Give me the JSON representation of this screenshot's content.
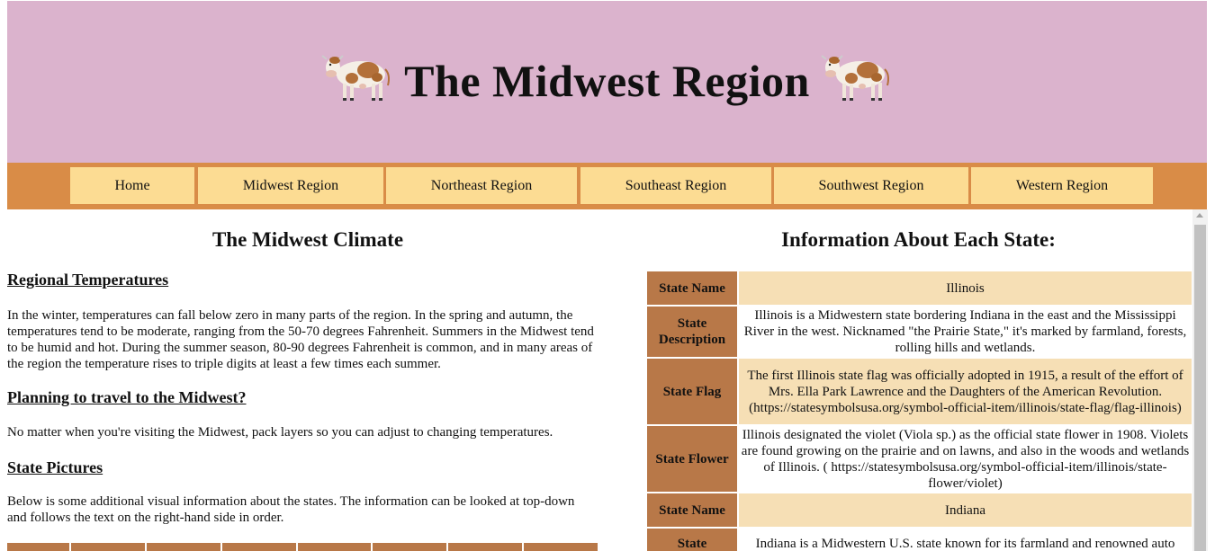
{
  "header": {
    "title": "The Midwest Region",
    "bg_color": "#dbb3cd",
    "left_icon": "cow-icon",
    "right_icon": "cow-icon"
  },
  "nav": {
    "bg_color": "#d98c47",
    "item_color": "#fcdc93",
    "items": [
      {
        "label": "Home"
      },
      {
        "label": "Midwest Region"
      },
      {
        "label": "Northeast Region"
      },
      {
        "label": "Southeast Region"
      },
      {
        "label": "Southwest Region"
      },
      {
        "label": "Western Region"
      }
    ]
  },
  "left": {
    "heading": "The Midwest Climate",
    "sections": [
      {
        "title": "Regional Temperatures",
        "text": "In the winter, temperatures can fall below zero in many parts of the region. In the spring and autumn, the temperatures tend to be moderate, ranging from the 50-70 degrees Fahrenheit. Summers in the Midwest tend to be humid and hot. During the summer season, 80-90 degrees Fahrenheit is common, and in many areas of the region the temperature rises to triple digits at least a few times each summer."
      },
      {
        "title": "Planning to travel to the Midwest?",
        "text": "No matter when you're visiting the Midwest, pack layers so you can adjust to changing temperatures."
      },
      {
        "title": "State Pictures",
        "text": "Below is some additional visual information about the states. The information can be looked at top-down and follows the text on the right-hand side in order."
      }
    ]
  },
  "right": {
    "heading": "Information About Each State:",
    "rows": [
      {
        "label": "State Name",
        "value": "Illinois"
      },
      {
        "label": "State Description",
        "value": "Illinois is a Midwestern state bordering Indiana in the east and the Mississippi River in the west. Nicknamed \"the Prairie State,\" it's marked by farmland, forests, rolling hills and wetlands."
      },
      {
        "label": "State Flag",
        "value": "The first Illinois state flag was officially adopted in 1915, a result of the effort of Mrs. Ella Park Lawrence and the Daughters of the American Revolution. (https://statesymbolsusa.org/symbol-official-item/illinois/state-flag/flag-illinois)"
      },
      {
        "label": "State Flower",
        "value": "Illinois designated the violet (Viola sp.) as the official state flower in 1908. Violets are found growing on the prairie and on lawns, and also in the woods and wetlands of Illinois. ( https://statesymbolsusa.org/symbol-official-item/illinois/state-flower/violet)"
      },
      {
        "label": "State Name",
        "value": "Indiana"
      },
      {
        "label": "State Description",
        "value": "Indiana is a Midwestern U.S. state known for its farmland and renowned auto"
      }
    ]
  }
}
